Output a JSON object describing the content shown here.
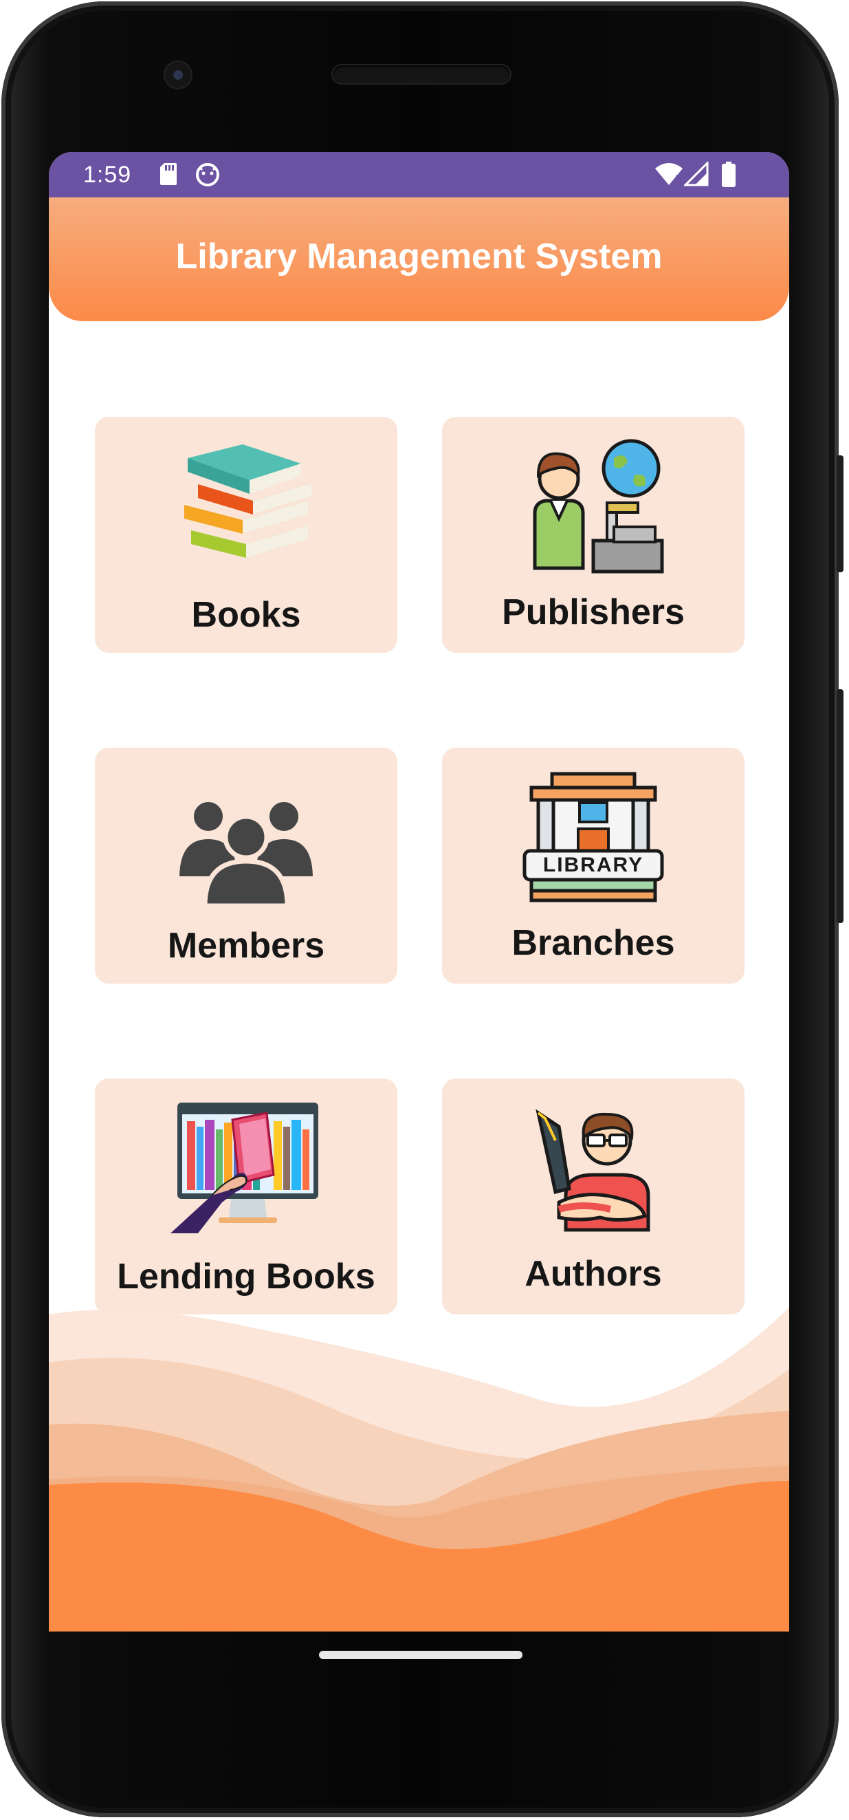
{
  "status_bar": {
    "time": "1:59",
    "left_icons": [
      "sd-card-icon",
      "android-debug-icon"
    ],
    "right_icons": [
      "wifi-icon",
      "cell-signal-icon",
      "battery-icon"
    ],
    "color": "#6b52a3"
  },
  "header": {
    "title": "Library Management System",
    "gradient_top": "#f6ad7e",
    "gradient_bottom": "#fc8a48"
  },
  "cards": [
    {
      "label": "Books",
      "icon": "books-stack-icon"
    },
    {
      "label": "Publishers",
      "icon": "publisher-icon"
    },
    {
      "label": "Members",
      "icon": "members-group-icon"
    },
    {
      "label": "Branches",
      "icon": "library-building-icon"
    },
    {
      "label": "Lending Books",
      "icon": "lending-books-icon"
    },
    {
      "label": "Authors",
      "icon": "author-pen-icon"
    }
  ],
  "theme": {
    "card_bg": "#fae5d8",
    "accent": "#fc8a48"
  }
}
